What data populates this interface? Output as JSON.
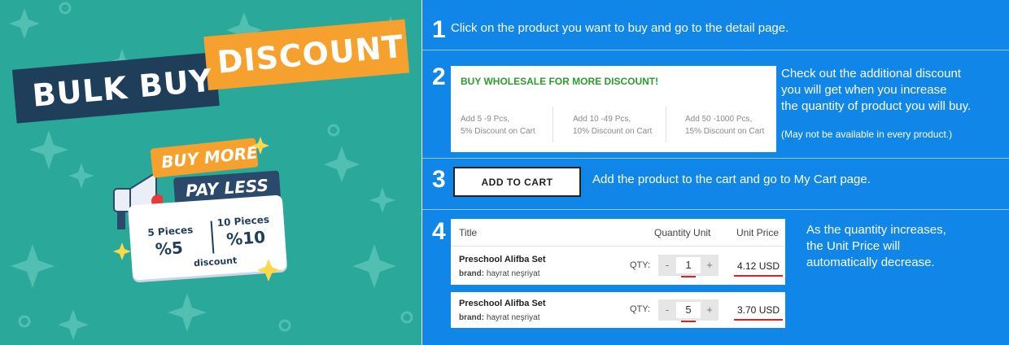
{
  "left_banner": {
    "title_part1": "BULK BUY",
    "title_part2": "DISCOUNT",
    "ribbon_top": "BUY MORE",
    "ribbon_bottom": "PAY LESS",
    "tier1_label": "5 Pieces",
    "tier1_value": "%5",
    "tier2_label": "10 Pieces",
    "tier2_value": "%10",
    "caption": "discount",
    "colors": {
      "teal": "#2aa89a",
      "navy": "#1f3e5a",
      "orange": "#f6a12e"
    }
  },
  "steps": [
    {
      "number": "1",
      "text": "Click on the product you want to buy and go to the detail page."
    },
    {
      "number": "2",
      "text_lines": [
        "Check out the additional discount",
        "you will get when you increase",
        "the quantity of product you will buy."
      ],
      "note": "(May not be available in every product.)"
    },
    {
      "number": "3",
      "text": "Add the product to the cart and go to My Cart page."
    },
    {
      "number": "4",
      "text_lines": [
        "As the quantity increases,",
        "the Unit Price will",
        "automatically decrease."
      ]
    }
  ],
  "wholesale_box": {
    "heading": "BUY WHOLESALE FOR MORE DISCOUNT!",
    "tiers": [
      {
        "line1": "Add 5 -9 Pcs,",
        "line2": "5% Discount on Cart"
      },
      {
        "line1": "Add 10 -49 Pcs,",
        "line2": "10% Discount on Cart"
      },
      {
        "line1": "Add 50 -1000 Pcs,",
        "line2": "15% Discount on Cart"
      }
    ]
  },
  "add_to_cart": {
    "label": "ADD TO CART"
  },
  "cart_table": {
    "headers": {
      "title": "Title",
      "quantity": "Quantity Unit",
      "price": "Unit Price"
    },
    "rows": [
      {
        "name": "Preschool Alifba Set",
        "brand_label": "brand:",
        "brand": "hayrat neşriyat",
        "qty_label": "QTY:",
        "minus": "-",
        "plus": "+",
        "quantity": "1",
        "price": "4.12 USD"
      },
      {
        "name": "Preschool Alifba Set",
        "brand_label": "brand:",
        "brand": "hayrat neşriyat",
        "qty_label": "QTY:",
        "minus": "-",
        "plus": "+",
        "quantity": "5",
        "price": "3.70 USD"
      }
    ]
  },
  "colors": {
    "right_bg": "#0f86e8",
    "wholesale_green": "#2e9a2e",
    "highlight_red": "#e02020"
  }
}
